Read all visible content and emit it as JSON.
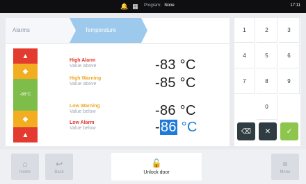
{
  "status_bar": {
    "icons": [
      "bell-icon",
      "grid-icon"
    ],
    "program_label": "Program:",
    "program_value": "None",
    "clock": "17:11"
  },
  "breadcrumb": {
    "items": [
      "Alarms",
      "Temperature"
    ]
  },
  "current_temperature": "-86°C",
  "thresholds": [
    {
      "title": "High Alarm",
      "subtitle": "Value above",
      "value": "-83",
      "unit": "°C"
    },
    {
      "title": "High Warning",
      "subtitle": "Value above",
      "value": "-85",
      "unit": "°C"
    },
    {
      "title": "Low Warning",
      "subtitle": "Value below",
      "value": "-86",
      "unit": "°C"
    },
    {
      "title": "Low Alarm",
      "subtitle": "Value below",
      "value": "86",
      "value_prefix": "-",
      "unit": "°C"
    }
  ],
  "keypad": {
    "keys": [
      "1",
      "2",
      "3",
      "4",
      "5",
      "6",
      "7",
      "8",
      "9",
      "0"
    ]
  },
  "bottom_nav": {
    "home": "Home",
    "back": "Back",
    "unlock": "Unlock door",
    "menu": "Menu"
  },
  "colors": {
    "alarm_red": "#e33b2f",
    "warning_yellow": "#f3ad21",
    "ok_green": "#7fbd4b",
    "selection_blue": "#1f7bd6",
    "breadcrumb_active": "#9cc9ec",
    "confirm_green": "#8dc54d"
  }
}
